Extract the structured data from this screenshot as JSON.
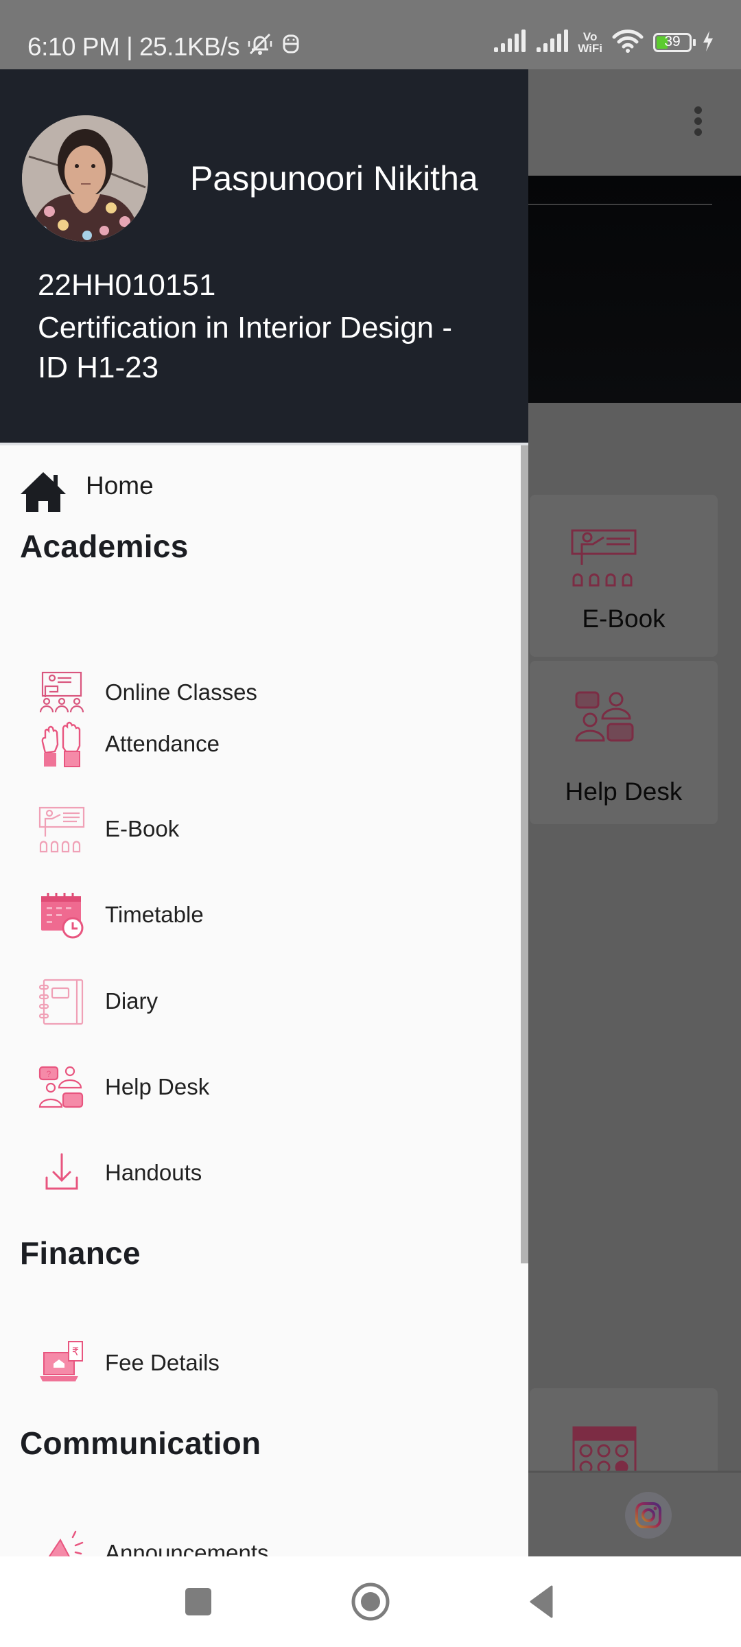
{
  "status_bar": {
    "time": "6:10 PM",
    "separator": "|",
    "network_speed": "25.1KB/s",
    "vowifi_top": "Vo",
    "vowifi_bottom": "WiFi",
    "battery_level": "39",
    "battery_percent": 39,
    "icons": [
      "bell-off-icon",
      "app-notification-icon",
      "signal-icon",
      "signal-icon",
      "vowifi-icon",
      "wifi-icon",
      "battery-icon",
      "charging-icon"
    ]
  },
  "drawer": {
    "header": {
      "user_name": "Paspunoori Nikitha",
      "user_id": "22HH010151",
      "course": "Certification in Interior Design - ID H1-23",
      "bg_color": "#1e222a"
    },
    "home": {
      "label": "Home",
      "icon": "home-icon"
    },
    "sections": [
      {
        "title": "Academics",
        "items": [
          {
            "label": "Online Classes",
            "icon": "online-classes-icon"
          },
          {
            "label": "Attendance",
            "icon": "raised-hands-icon"
          },
          {
            "label": "E-Book",
            "icon": "presentation-icon"
          },
          {
            "label": "Timetable",
            "icon": "calendar-clock-icon"
          },
          {
            "label": "Diary",
            "icon": "notebook-icon"
          },
          {
            "label": "Help Desk",
            "icon": "help-desk-icon"
          },
          {
            "label": "Handouts",
            "icon": "download-icon"
          }
        ]
      },
      {
        "title": "Finance",
        "items": [
          {
            "label": "Fee Details",
            "icon": "fee-laptop-icon"
          }
        ]
      },
      {
        "title": "Communication",
        "items": [
          {
            "label": "Announcements",
            "icon": "megaphone-icon"
          }
        ]
      }
    ],
    "accent_color": "#e8557f"
  },
  "background_app": {
    "cards": [
      {
        "label": "E-Book",
        "icon": "presentation-icon"
      },
      {
        "label": "Help Desk",
        "icon": "help-desk-icon"
      }
    ],
    "bottom_icons": [
      "instagram-icon"
    ],
    "menu_icon": "kebab-menu-icon"
  },
  "nav_bar": {
    "buttons": [
      "recents",
      "home",
      "back"
    ]
  }
}
